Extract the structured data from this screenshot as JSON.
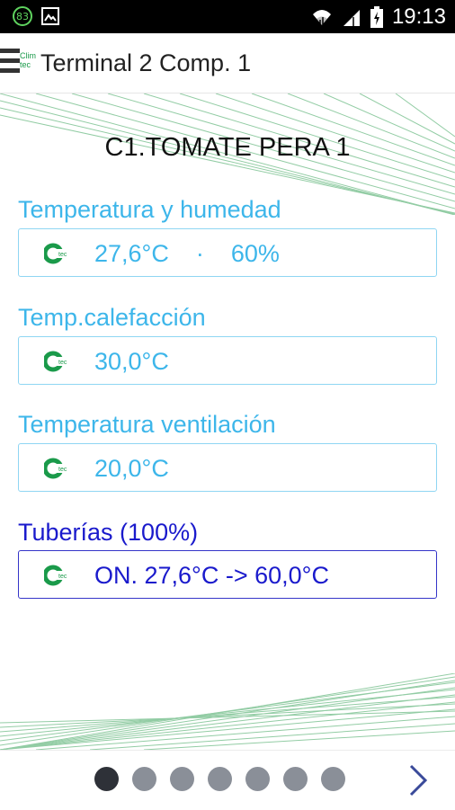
{
  "status_bar": {
    "notification_count": "83",
    "time": "19:13"
  },
  "app_bar": {
    "logo_text": "Clim tec",
    "title": "Terminal 2 Comp. 1"
  },
  "record": {
    "title": "C1.TOMATE PERA 1"
  },
  "groups": [
    {
      "label": "Temperatura y humedad",
      "value": "27,6°C    ·    60%",
      "active": false
    },
    {
      "label": "Temp.calefacción",
      "value": "30,0°C",
      "active": false
    },
    {
      "label": "Temperatura ventilación",
      "value": "20,0°C",
      "active": false
    },
    {
      "label": "Tuberías (100%)",
      "value": "ON. 27,6°C -> 60,0°C",
      "active": true
    }
  ],
  "pager": {
    "page_count": 7,
    "current_page": 1
  },
  "colors": {
    "accent_light": "#3db6ea",
    "accent_active": "#1a1acc",
    "logo_green": "#1a9a4a",
    "deco_green": "#3aa35a"
  },
  "icons": [
    "notification-badge-icon",
    "image-icon",
    "wifi-icon",
    "signal-icon",
    "battery-icon",
    "menu-icon",
    "climatec-logo-icon",
    "chevron-right-icon"
  ]
}
